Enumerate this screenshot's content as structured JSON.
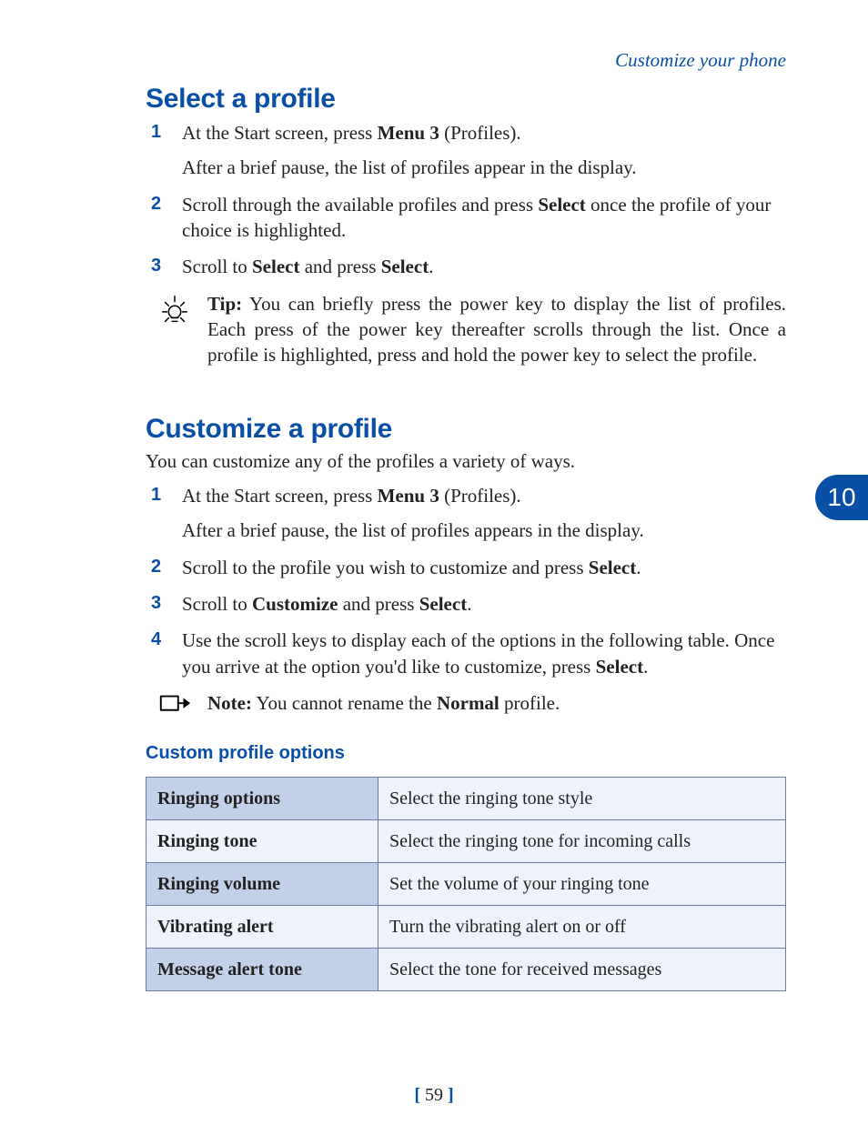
{
  "header": {
    "running": "Customize your phone"
  },
  "chapter": "10",
  "page_number": "59",
  "section1": {
    "title": "Select a profile",
    "steps": [
      {
        "pre": "At the Start screen, press ",
        "bold": "Menu 3",
        "post": " (Profiles).",
        "sub": "After a brief pause, the list of profiles appear in the display."
      },
      {
        "pre": "Scroll through the available profiles and press ",
        "bold": "Select",
        "post": " once the profile of your choice is highlighted."
      },
      {
        "pre": "Scroll to ",
        "bold": "Select",
        "mid": " and press ",
        "bold2": "Select",
        "post": "."
      }
    ],
    "tip": {
      "label": "Tip:",
      "body": " You can briefly press the power key to display the list of profiles. Each press of the power key thereafter scrolls through the list. Once a profile is highlighted, press and hold the power key to select the profile."
    }
  },
  "section2": {
    "title": "Customize a profile",
    "intro": "You can customize any of the profiles a variety of ways.",
    "steps": [
      {
        "pre": "At the Start screen, press ",
        "bold": "Menu 3",
        "post": " (Profiles).",
        "sub": "After a brief pause, the list of profiles appears in the display."
      },
      {
        "pre": "Scroll to the profile you wish to customize and press ",
        "bold": "Select",
        "post": "."
      },
      {
        "pre": "Scroll to ",
        "bold": "Customize",
        "mid": " and press ",
        "bold2": "Select",
        "post": "."
      },
      {
        "pre": "Use the scroll keys to display each of the options in the following table. Once you arrive at the option you'd like to customize, press ",
        "bold": "Select",
        "post": "."
      }
    ],
    "note": {
      "label": "Note:",
      "pre": " You cannot rename the ",
      "bold": "Normal",
      "post": " profile."
    },
    "table_title": "Custom profile options",
    "options": [
      {
        "k": "Ringing options",
        "v": "Select the ringing tone style"
      },
      {
        "k": "Ringing tone",
        "v": "Select the ringing tone for incoming calls"
      },
      {
        "k": "Ringing volume",
        "v": "Set the volume of your ringing tone"
      },
      {
        "k": "Vibrating alert",
        "v": "Turn the vibrating alert on or off"
      },
      {
        "k": "Message alert tone",
        "v": "Select the tone for received messages"
      }
    ]
  }
}
